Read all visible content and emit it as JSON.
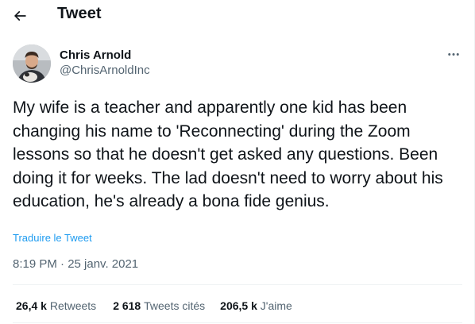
{
  "header": {
    "title": "Tweet"
  },
  "tweet": {
    "author_name": "Chris Arnold",
    "author_handle": "@ChrisArnoldInc",
    "text": "My wife is a teacher and apparently one kid has been changing his name to 'Reconnecting' during the Zoom lessons so that he doesn't get asked any questions. Been doing it for weeks. The lad doesn't need to worry about his education, he's already a bona fide genius.",
    "translate_label": "Traduire le Tweet",
    "timestamp": "8:19 PM · 25 janv. 2021"
  },
  "stats": [
    {
      "count": "26,4 k",
      "label": "Retweets"
    },
    {
      "count": "2 618",
      "label": "Tweets cités"
    },
    {
      "count": "206,5 k",
      "label": "J'aime"
    }
  ],
  "icons": {
    "back": "arrow-left-icon",
    "more": "more-horizontal-icon"
  },
  "colors": {
    "accent": "#1d9bf0",
    "text_primary": "#0f1419",
    "text_secondary": "#536471",
    "divider": "#eff3f4"
  }
}
